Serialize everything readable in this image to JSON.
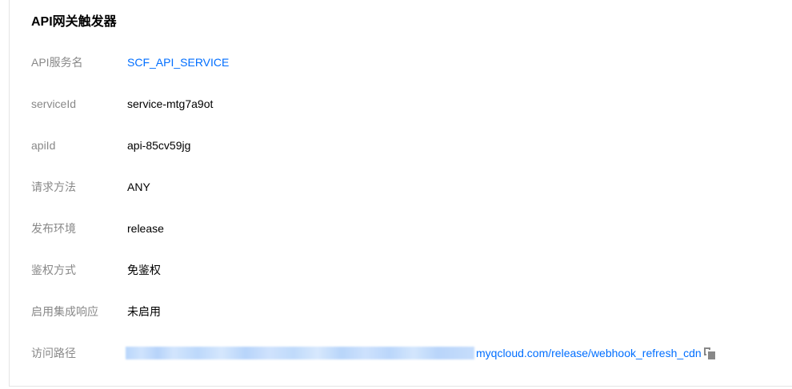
{
  "section": {
    "title": "API网关触发器"
  },
  "fields": [
    {
      "label": "API服务名",
      "value": "SCF_API_SERVICE"
    },
    {
      "label": "serviceId",
      "value": "service-mtg7a9ot"
    },
    {
      "label": "apiId",
      "value": "api-85cv59jg"
    },
    {
      "label": "请求方法",
      "value": "ANY"
    },
    {
      "label": "发布环境",
      "value": "release"
    },
    {
      "label": "鉴权方式",
      "value": "免鉴权"
    },
    {
      "label": "启用集成响应",
      "value": "未启用"
    },
    {
      "label": "访问路径",
      "value": "myqcloud.com/release/webhook_refresh_cdn"
    }
  ],
  "icons": {
    "copy": "copy-icon"
  },
  "colors": {
    "link": "#006eff",
    "label": "#888888",
    "value": "#000000"
  }
}
